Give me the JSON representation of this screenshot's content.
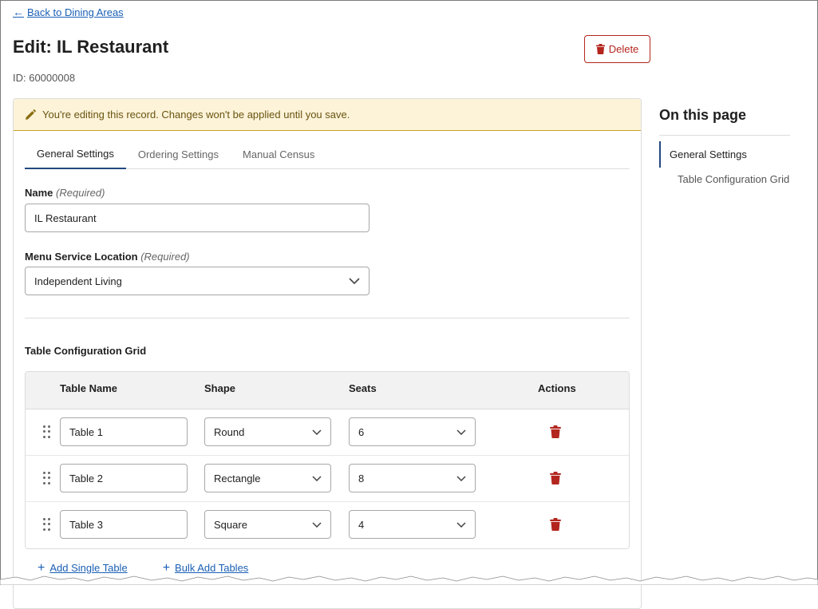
{
  "back_link": {
    "label": "Back to Dining Areas"
  },
  "header": {
    "title": "Edit: IL Restaurant",
    "id_text": "ID: 60000008",
    "delete_label": "Delete"
  },
  "banner": {
    "text": "You're editing this record. Changes won't be applied until you save."
  },
  "tabs": [
    {
      "label": "General Settings",
      "active": true
    },
    {
      "label": "Ordering Settings",
      "active": false
    },
    {
      "label": "Manual Census",
      "active": false
    }
  ],
  "form": {
    "name_label": "Name",
    "name_required": "(Required)",
    "name_value": "IL Restaurant",
    "location_label": "Menu Service Location",
    "location_required": "(Required)",
    "location_value": "Independent Living"
  },
  "grid": {
    "title": "Table Configuration Grid",
    "columns": [
      "Table Name",
      "Shape",
      "Seats",
      "Actions"
    ],
    "rows": [
      {
        "name": "Table 1",
        "shape": "Round",
        "seats": "6"
      },
      {
        "name": "Table 2",
        "shape": "Rectangle",
        "seats": "8"
      },
      {
        "name": "Table 3",
        "shape": "Square",
        "seats": "4"
      }
    ],
    "add_single_label": "Add Single Table",
    "bulk_add_label": "Bulk Add Tables"
  },
  "on_this_page": {
    "title": "On this page",
    "items": [
      {
        "label": "General Settings",
        "active": true
      },
      {
        "label": "Table Configuration Grid",
        "active": false
      }
    ]
  },
  "colors": {
    "accent": "#23487f",
    "link": "#1a5fb4",
    "danger": "#b3261e",
    "banner_bg": "#fcf3d9"
  }
}
